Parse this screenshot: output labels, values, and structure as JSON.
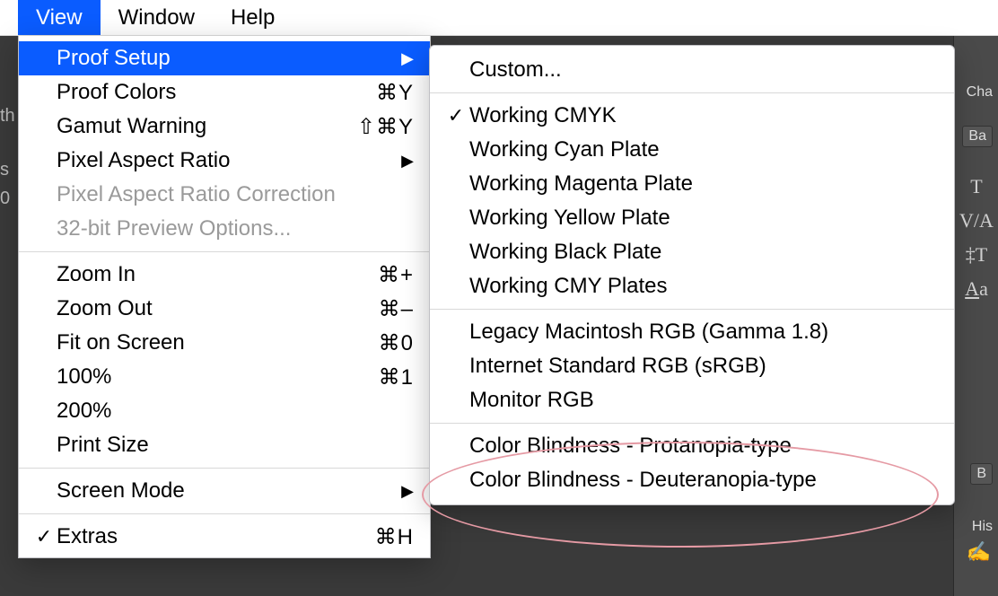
{
  "menubar": {
    "view": "View",
    "window": "Window",
    "help": "Help"
  },
  "viewMenu": {
    "proofSetup": "Proof Setup",
    "proofColors": "Proof Colors",
    "proofColors_sc": "⌘Y",
    "gamutWarning": "Gamut Warning",
    "gamutWarning_sc": "⇧⌘Y",
    "pixelAspect": "Pixel Aspect Ratio",
    "pixelAspectCorrection": "Pixel Aspect Ratio Correction",
    "bit32": "32-bit Preview Options...",
    "zoomIn": "Zoom In",
    "zoomIn_sc": "⌘+",
    "zoomOut": "Zoom Out",
    "zoomOut_sc": "⌘–",
    "fitOnScreen": "Fit on Screen",
    "fitOnScreen_sc": "⌘0",
    "pct100": "100%",
    "pct100_sc": "⌘1",
    "pct200": "200%",
    "printSize": "Print Size",
    "screenMode": "Screen Mode",
    "extras": "Extras",
    "extras_sc": "⌘H"
  },
  "proofSetup": {
    "custom": "Custom...",
    "workingCMYK": "Working CMYK",
    "workingCyan": "Working Cyan Plate",
    "workingMagenta": "Working Magenta Plate",
    "workingYellow": "Working Yellow Plate",
    "workingBlack": "Working Black Plate",
    "workingCMY": "Working CMY Plates",
    "legacyMac": "Legacy Macintosh RGB (Gamma 1.8)",
    "internetRGB": "Internet Standard RGB (sRGB)",
    "monitorRGB": "Monitor RGB",
    "protanopia": "Color Blindness - Protanopia-type",
    "deuteranopia": "Color Blindness - Deuteranopia-type"
  },
  "sidePanels": {
    "cha": "Cha",
    "ba": "Ba",
    "his": "His",
    "b": "B"
  },
  "glyphs": {
    "arrowRight": "▶",
    "check": "✓"
  }
}
